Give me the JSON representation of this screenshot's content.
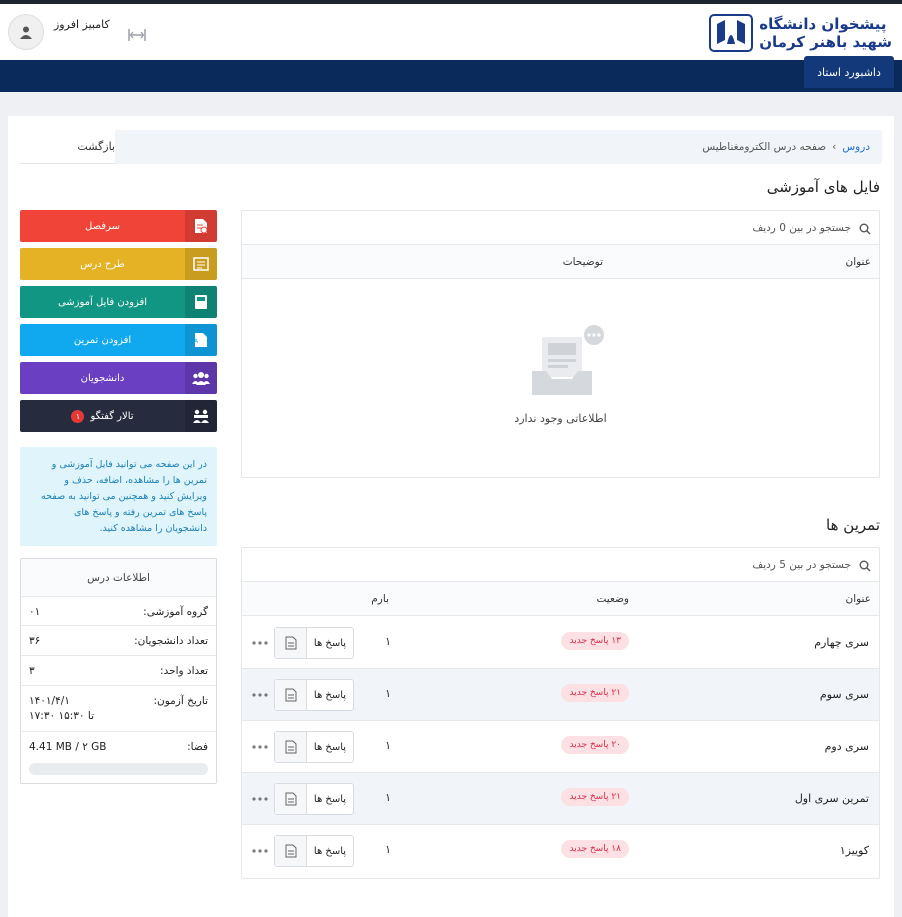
{
  "header": {
    "logo_line1": "پیشخوان دانشگاه",
    "logo_line2": "شهید باهنر کرمان",
    "user_name": "کامبیز افروز",
    "nav_tab": "داشبورد استاد"
  },
  "breadcrumb": {
    "root": "دروس",
    "separator": "›",
    "current": "صفحه درس الکترومغناطیس",
    "back_label": "بازگشت"
  },
  "files": {
    "title": "فایل های آموزشی",
    "search_label": "جستجو در بین 0 ردیف",
    "columns": [
      "عنوان",
      "توضیحات"
    ],
    "empty_text": "اطلاعاتی وجود ندارد"
  },
  "exercises": {
    "title": "تمرین ها",
    "search_label": "جستجو در بین 5 ردیف",
    "columns": [
      "عنوان",
      "وضعیت",
      "بارم"
    ],
    "answers_label": "پاسخ ها",
    "rows": [
      {
        "title": "سری چهارم",
        "badge": "۱۳ پاسخ جدید",
        "score": "۱"
      },
      {
        "title": "سری سوم",
        "badge": "۲۱ پاسخ جدید",
        "score": "۱"
      },
      {
        "title": "سری دوم",
        "badge": "۲۰ پاسخ جدید",
        "score": "۱"
      },
      {
        "title": "تمرین سری اول",
        "badge": "۲۱ پاسخ جدید",
        "score": "۱"
      },
      {
        "title": "کوییز۱",
        "badge": "۱۸ پاسخ جدید",
        "score": "۱"
      }
    ]
  },
  "sidebar": {
    "buttons": [
      {
        "label": "سرفصل",
        "color": "#f04438"
      },
      {
        "label": "طرح درس",
        "color": "#e5b225"
      },
      {
        "label": "افزودن فایل آموزشی",
        "color": "#109683"
      },
      {
        "label": "افزودن تمرین",
        "color": "#10a9ef"
      },
      {
        "label": "دانشجویان",
        "color": "#6a3fc1"
      },
      {
        "label": "تالار گفتگو",
        "color": "#262b3d",
        "badge": "۱"
      }
    ],
    "info_text": "در این صفحه می توانید فایل آموزشی و تمرین ها را مشاهده، اضافه، حذف و ویرایش کنید و همچنین می توانید به صفحه پاسخ های تمرین رفته و پاسخ های دانشجویان را مشاهده کنید."
  },
  "course_info": {
    "title": "اطلاعات درس",
    "rows": [
      {
        "key": "گروه آموزشی:",
        "value": "۰۱"
      },
      {
        "key": "تعداد دانشجویان:",
        "value": "۳۶"
      },
      {
        "key": "تعداد واحد:",
        "value": "۳"
      },
      {
        "key": "تاریخ آزمون:",
        "value": "۱۴۰۱/۴/۱",
        "value2": "۱۷:۳۰ تا ۱۵:۳۰"
      },
      {
        "key": "فضا:",
        "value": "4.41 MB / ۲ GB"
      }
    ],
    "storage_used_fraction": 0.002
  }
}
